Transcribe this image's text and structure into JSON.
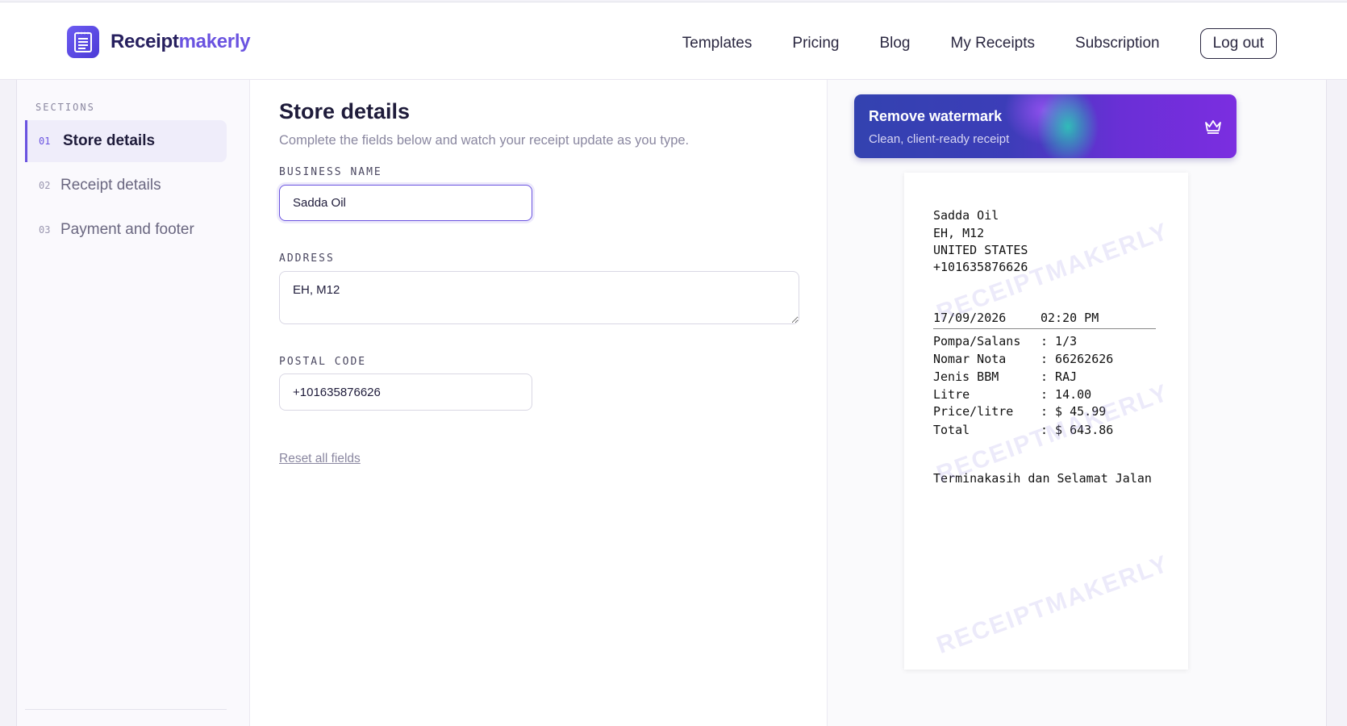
{
  "brand": {
    "name_part1": "Receipt",
    "name_part2": "makerly",
    "accent_color": "#6a53e0"
  },
  "nav": {
    "links": [
      "Templates",
      "Pricing",
      "Blog",
      "My Receipts",
      "Subscription"
    ],
    "logout": "Log out"
  },
  "sidebar": {
    "heading": "SECTIONS",
    "items": [
      {
        "num": "01",
        "label": "Store details",
        "active": true
      },
      {
        "num": "02",
        "label": "Receipt details",
        "active": false
      },
      {
        "num": "03",
        "label": "Payment and footer",
        "active": false
      }
    ]
  },
  "form": {
    "title": "Store details",
    "subtitle": "Complete the fields below and watch your receipt update as you type.",
    "business_name_label": "BUSINESS NAME",
    "business_name_value": "Sadda Oil",
    "address_label": "ADDRESS",
    "address_value": "EH, M12",
    "postal_label": "POSTAL CODE",
    "postal_value": "+101635876626",
    "reset": "Reset all fields"
  },
  "banner": {
    "title": "Remove watermark",
    "subtitle": "Clean, client-ready receipt",
    "icon": "crown-icon"
  },
  "receipt": {
    "store": "Sadda Oil",
    "address": "EH, M12",
    "country": "UNITED STATES",
    "phone": "+101635876626",
    "date": "17/09/2026",
    "time": "02:20 PM",
    "rows": [
      {
        "k": "Pompa/Salans",
        "v": ": 1/3"
      },
      {
        "k": "Nomar Nota",
        "v": ": 66262626"
      },
      {
        "k": "Jenis BBM",
        "v": ": RAJ"
      },
      {
        "k": "Litre",
        "v": ": 14.00"
      },
      {
        "k": "Price/litre",
        "v": ": $ 45.99"
      },
      {
        "k": "Total",
        "v": ": $ 643.86"
      }
    ],
    "footer": "Terminakasih dan Selamat Jalan",
    "watermark": "RECEIPTMAKERLY"
  }
}
